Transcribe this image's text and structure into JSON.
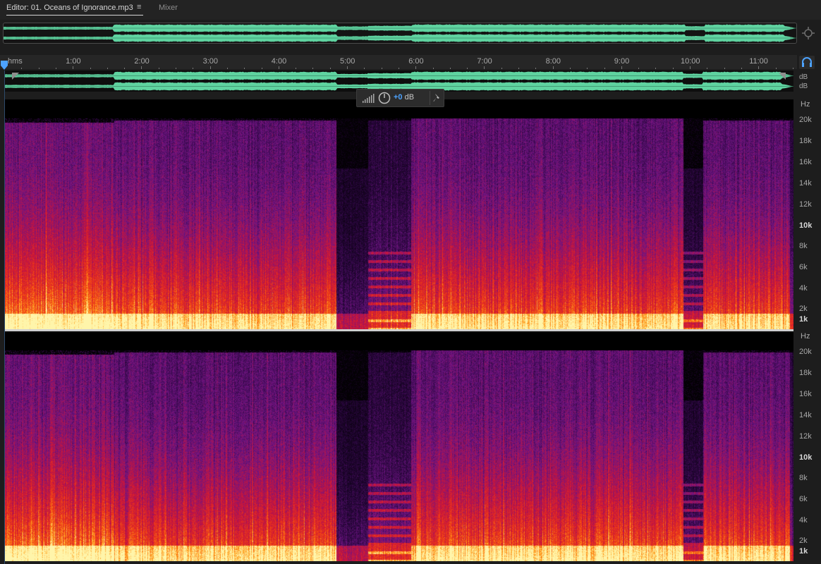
{
  "tabs": {
    "editor": "Editor: 01. Oceans of Ignorance.mp3",
    "menu_glyph": "≡",
    "mixer": "Mixer"
  },
  "ruler": {
    "unit": "hms",
    "labels": [
      "1:00",
      "2:00",
      "3:00",
      "4:00",
      "5:00",
      "6:00",
      "7:00",
      "8:00",
      "9:00",
      "10:00",
      "11:00"
    ]
  },
  "waveform": {
    "channel_units": [
      "dB",
      "dB"
    ],
    "color": "#5fd3a0"
  },
  "hud": {
    "value": "+0",
    "unit": " dB",
    "icons": [
      "meter-icon",
      "volume-knob-icon",
      "pin-icon"
    ]
  },
  "spectral": {
    "hz_unit": "Hz",
    "labels": [
      "20k",
      "18k",
      "16k",
      "14k",
      "12k",
      "10k",
      "8k",
      "6k",
      "4k",
      "2k",
      "1k"
    ],
    "bold_labels": [
      "10k",
      "1k"
    ]
  },
  "icons": [
    "zoom-navigator-icon",
    "headphones-icon",
    "playhead-icon",
    "fade-in-handle-icon",
    "fade-out-handle-icon"
  ]
}
